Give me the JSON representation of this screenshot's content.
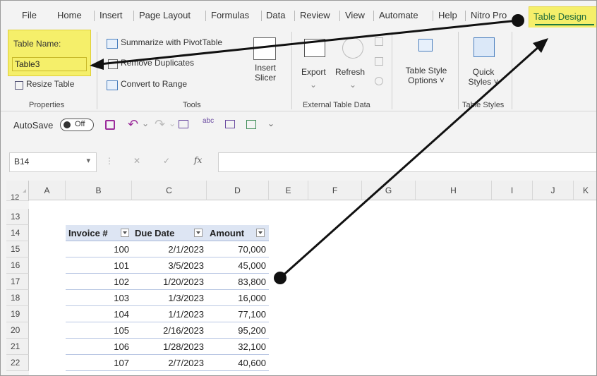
{
  "menu": {
    "tabs": [
      "File",
      "Home",
      "Insert",
      "Page Layout",
      "Formulas",
      "Data",
      "Review",
      "View",
      "Automate",
      "Help",
      "Nitro Pro"
    ],
    "active_tab": "Table Design"
  },
  "ribbon": {
    "properties": {
      "table_name_label": "Table Name:",
      "table_name_value": "Table3",
      "resize_table": "Resize Table",
      "group_label": "Properties"
    },
    "tools": {
      "summarize": "Summarize with PivotTable",
      "remove_duplicates": "Remove Duplicates",
      "convert_to_range": "Convert to Range",
      "insert_slicer_1": "Insert",
      "insert_slicer_2": "Slicer",
      "group_label": "Tools"
    },
    "external": {
      "export": "Export",
      "refresh": "Refresh",
      "group_label": "External Table Data"
    },
    "style_options": {
      "line1": "Table Style",
      "line2": "Options ˅"
    },
    "table_styles": {
      "quick_1": "Quick",
      "quick_2": "Styles ˅",
      "group_label": "Table Styles"
    }
  },
  "qat": {
    "autosave_label": "AutoSave",
    "toggle_state": "Off"
  },
  "formula_bar": {
    "name_box": "B14",
    "fx": "fx",
    "cancel": "✕",
    "enter": "✓",
    "content": ""
  },
  "columns": [
    "A",
    "B",
    "C",
    "D",
    "E",
    "F",
    "G",
    "H",
    "I",
    "J",
    "K"
  ],
  "rows": [
    "12",
    "13",
    "14",
    "15",
    "16",
    "17",
    "18",
    "19",
    "20",
    "21",
    "22"
  ],
  "table": {
    "headers": [
      "Invoice #",
      "Due Date",
      "Amount"
    ],
    "rows": [
      [
        "100",
        "2/1/2023",
        "70,000"
      ],
      [
        "101",
        "3/5/2023",
        "45,000"
      ],
      [
        "102",
        "1/20/2023",
        "83,800"
      ],
      [
        "103",
        "1/3/2023",
        "16,000"
      ],
      [
        "104",
        "1/1/2023",
        "77,100"
      ],
      [
        "105",
        "2/16/2023",
        "95,200"
      ],
      [
        "106",
        "1/28/2023",
        "32,100"
      ],
      [
        "107",
        "2/7/2023",
        "40,600"
      ]
    ]
  },
  "colors": {
    "highlight": "#f5ef6a",
    "arrow": "#111111",
    "header_fill": "#dde5f3",
    "accent": "#1f7a3f"
  }
}
